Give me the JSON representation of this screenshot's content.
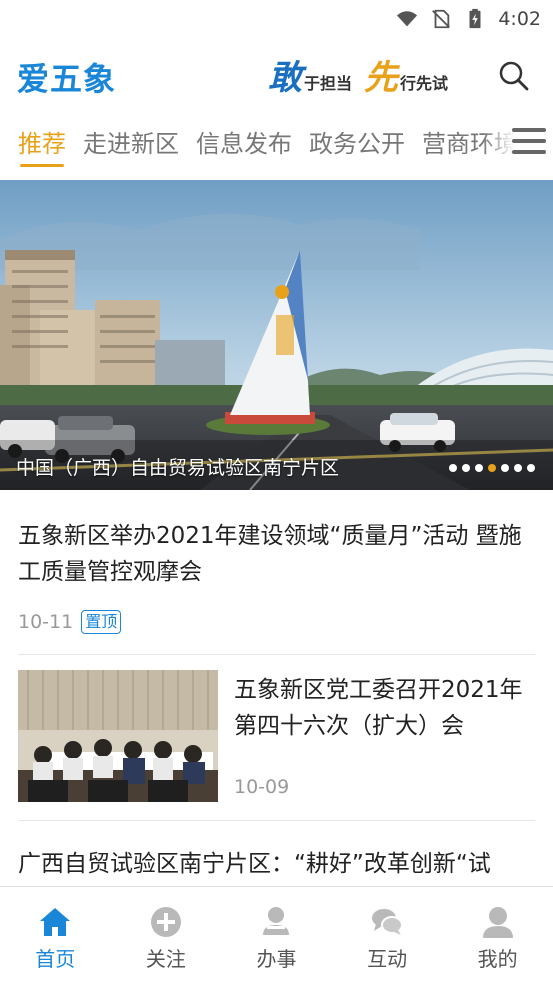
{
  "status_bar": {
    "time": "4:02"
  },
  "header": {
    "logo": "爱五象",
    "slogan": {
      "char1": "敢",
      "text1": "于担当",
      "char2": "先",
      "text2": "行先试"
    }
  },
  "tabs": [
    "推荐",
    "走进新区",
    "信息发布",
    "政务公开",
    "营商环境"
  ],
  "banner": {
    "caption": "中国（广西）自由贸易试验区南宁片区",
    "dot_count": 7,
    "active_dot": 3
  },
  "news": [
    {
      "title": "五象新区举办2021年建设领域“质量月”活动 暨施工质量管控观摩会",
      "date": "10-11",
      "badge": "置顶"
    },
    {
      "title": "五象新区党工委召开2021年第四十六次（扩大）会",
      "date": "10-09"
    },
    {
      "title": "广西自贸试验区南宁片区：“耕好”改革创新“试"
    }
  ],
  "bottom_nav": [
    {
      "label": "首页",
      "icon": "home-icon"
    },
    {
      "label": "关注",
      "icon": "plus-circle-icon"
    },
    {
      "label": "办事",
      "icon": "service-person-icon"
    },
    {
      "label": "互动",
      "icon": "chat-icon"
    },
    {
      "label": "我的",
      "icon": "user-icon"
    }
  ],
  "colors": {
    "accent": "#e8a21a",
    "brand": "#1a86d8"
  }
}
